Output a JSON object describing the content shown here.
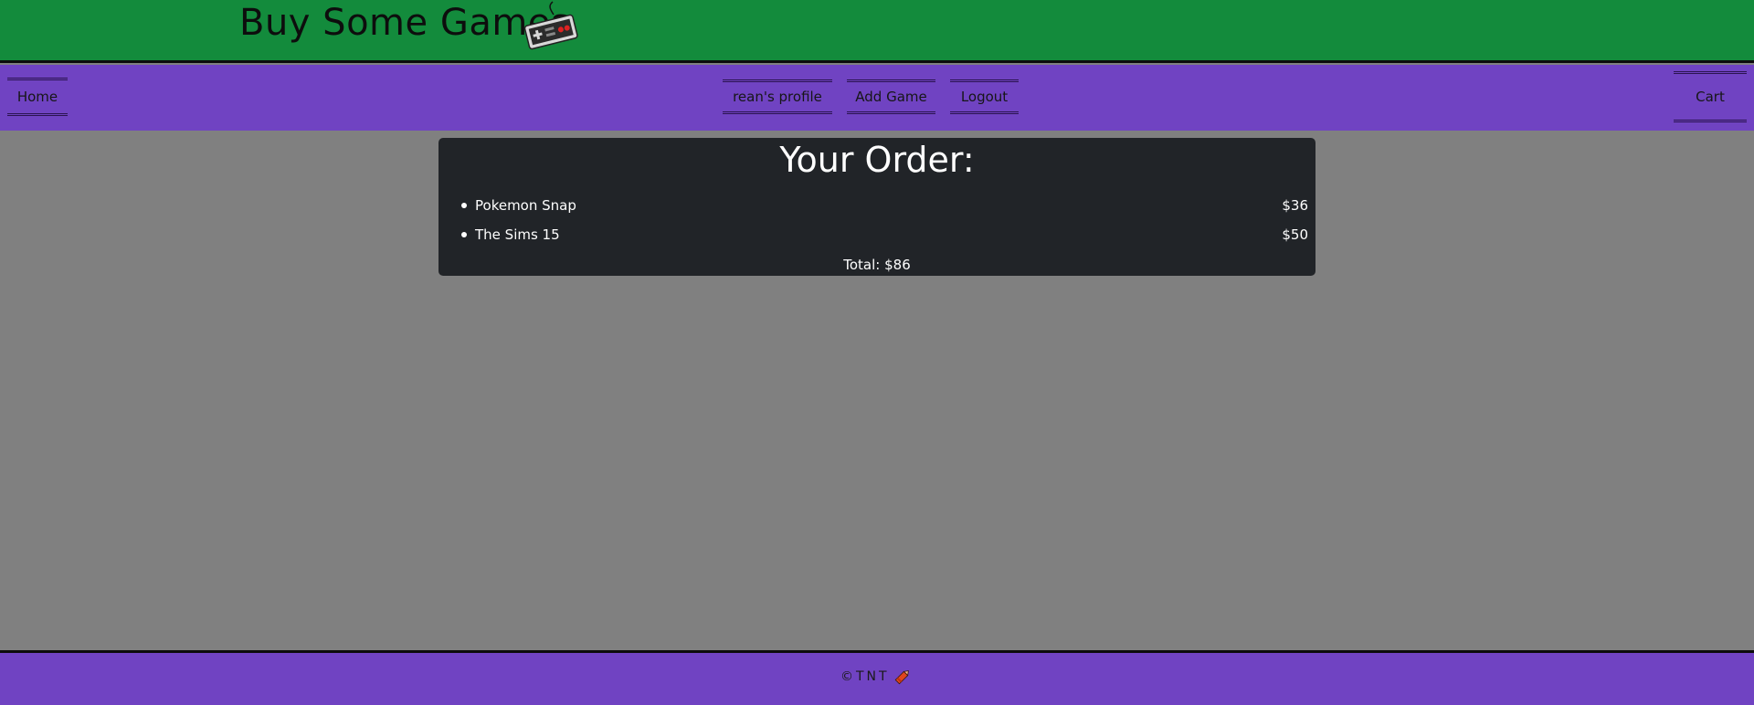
{
  "header": {
    "title": "Buy Some Games",
    "logo_icon": "game-controller-icon"
  },
  "nav": {
    "home": "Home",
    "profile": "rean's profile",
    "add_game": "Add Game",
    "logout": "Logout",
    "cart": "Cart"
  },
  "order": {
    "heading": "Your Order:",
    "items": [
      {
        "name": "Pokemon Snap",
        "price": "$36"
      },
      {
        "name": "The Sims 15",
        "price": "$50"
      }
    ],
    "total": "Total: $86"
  },
  "footer": {
    "text": "©TNT",
    "icon": "crayon-icon"
  },
  "colors": {
    "header_bg": "#138b3c",
    "nav_bg": "#7043c2",
    "page_bg": "#808080",
    "card_bg": "#212428"
  }
}
